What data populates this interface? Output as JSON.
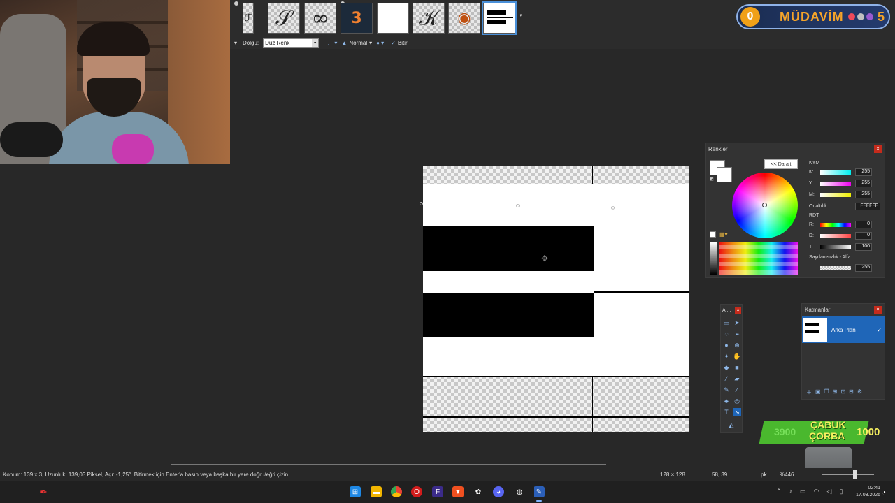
{
  "options_bar": {
    "fill_label": "Dolgu:",
    "fill_value": "Düz Renk",
    "blend_mode": "Normal",
    "finish_label": "Bitir"
  },
  "badge": {
    "coin": "0",
    "word": "MÜDAVİM",
    "level": "5"
  },
  "colors_panel": {
    "title": "Renkler",
    "shrink_button": "<< Daralt",
    "kym_label": "KYM",
    "k": {
      "label": "K:",
      "value": "255"
    },
    "y": {
      "label": "Y:",
      "value": "255"
    },
    "m": {
      "label": "M:",
      "value": "255"
    },
    "hex_label": "Onaltılık:",
    "hex_value": "FFFFFF",
    "rdt_label": "RDT",
    "r": {
      "label": "R:",
      "value": "0"
    },
    "d": {
      "label": "D:",
      "value": "0"
    },
    "t": {
      "label": "T:",
      "value": "100"
    },
    "alpha_label": "Saydamsızlık - Alfa",
    "alpha_value": "255"
  },
  "tools_panel": {
    "title": "Ar..."
  },
  "layers_panel": {
    "title": "Katmanlar",
    "layer_name": "Arka Plan"
  },
  "alert": {
    "left_number": "3900",
    "line1": "ÇABUK",
    "line2": "ÇORBA",
    "right_number": "1000"
  },
  "status": {
    "message": "Konum: 139 x 3, Uzunluk: 139,03 Piksel, Açı: -1,25°. Bitirmek için Enter'a basın veya başka bir yere doğru/eğri çizin.",
    "image_size": "128 × 128",
    "cursor_pos": "58, 39",
    "unit": "pk",
    "zoom": "%446"
  },
  "clock": {
    "time": "02:41",
    "date": "17.03.2026"
  },
  "colors": {
    "accent": "#1f66b8",
    "badge_text": "#f3a32a",
    "alert_green": "#4ab82e"
  }
}
